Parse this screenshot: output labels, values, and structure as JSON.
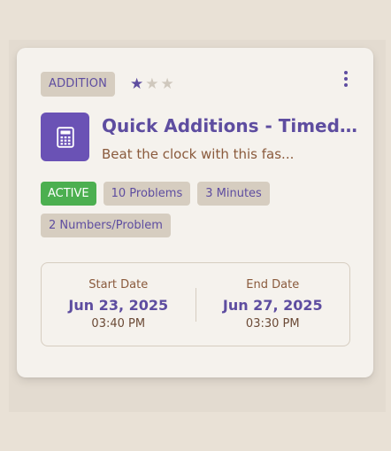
{
  "card": {
    "category": "ADDITION",
    "rating": {
      "filled": 1,
      "total": 3
    },
    "icon": "calculator-icon",
    "title": "Quick Additions - Timed Ro...",
    "description": "Beat the clock with this fas...",
    "tags": {
      "status": "ACTIVE",
      "problems": "10 Problems",
      "duration": "3 Minutes",
      "numbers": "2 Numbers/Problem"
    },
    "start": {
      "label": "Start Date",
      "date": "Jun 23, 2025",
      "time": "03:40 PM"
    },
    "end": {
      "label": "End Date",
      "date": "Jun 27, 2025",
      "time": "03:30 PM"
    }
  },
  "colors": {
    "accent": "#5e4da0",
    "icon_bg": "#6a52b5",
    "status_green": "#4caf50",
    "tag_bg": "#d6cdc0",
    "description": "#8a5a3c"
  }
}
